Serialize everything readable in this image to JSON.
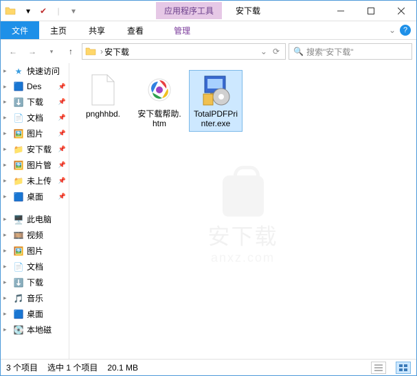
{
  "title": "安下载",
  "context_tab": "应用程序工具",
  "ribbon": {
    "file": "文件",
    "home": "主页",
    "share": "共享",
    "view": "查看",
    "manage": "管理"
  },
  "address": {
    "current": "安下载",
    "search_placeholder": "搜索\"安下载\""
  },
  "sidebar": {
    "quick": "快速访问",
    "items": [
      "Des",
      "下载",
      "文档",
      "图片",
      "安下载",
      "图片管",
      "未上传",
      "桌面"
    ],
    "pc": "此电脑",
    "pc_items": [
      "视频",
      "图片",
      "文档",
      "下载",
      "音乐",
      "桌面",
      "本地磁"
    ]
  },
  "files": [
    {
      "name": "pnghhbd.",
      "selected": false,
      "kind": "blank"
    },
    {
      "name": "安下载帮助.htm",
      "selected": false,
      "kind": "htm"
    },
    {
      "name": "TotalPDFPrinter.exe",
      "selected": true,
      "kind": "exe"
    }
  ],
  "watermark": {
    "l1": "安下载",
    "l2": "anxz.com"
  },
  "status": {
    "count": "3 个项目",
    "selection": "选中 1 个项目",
    "size": "20.1 MB"
  }
}
